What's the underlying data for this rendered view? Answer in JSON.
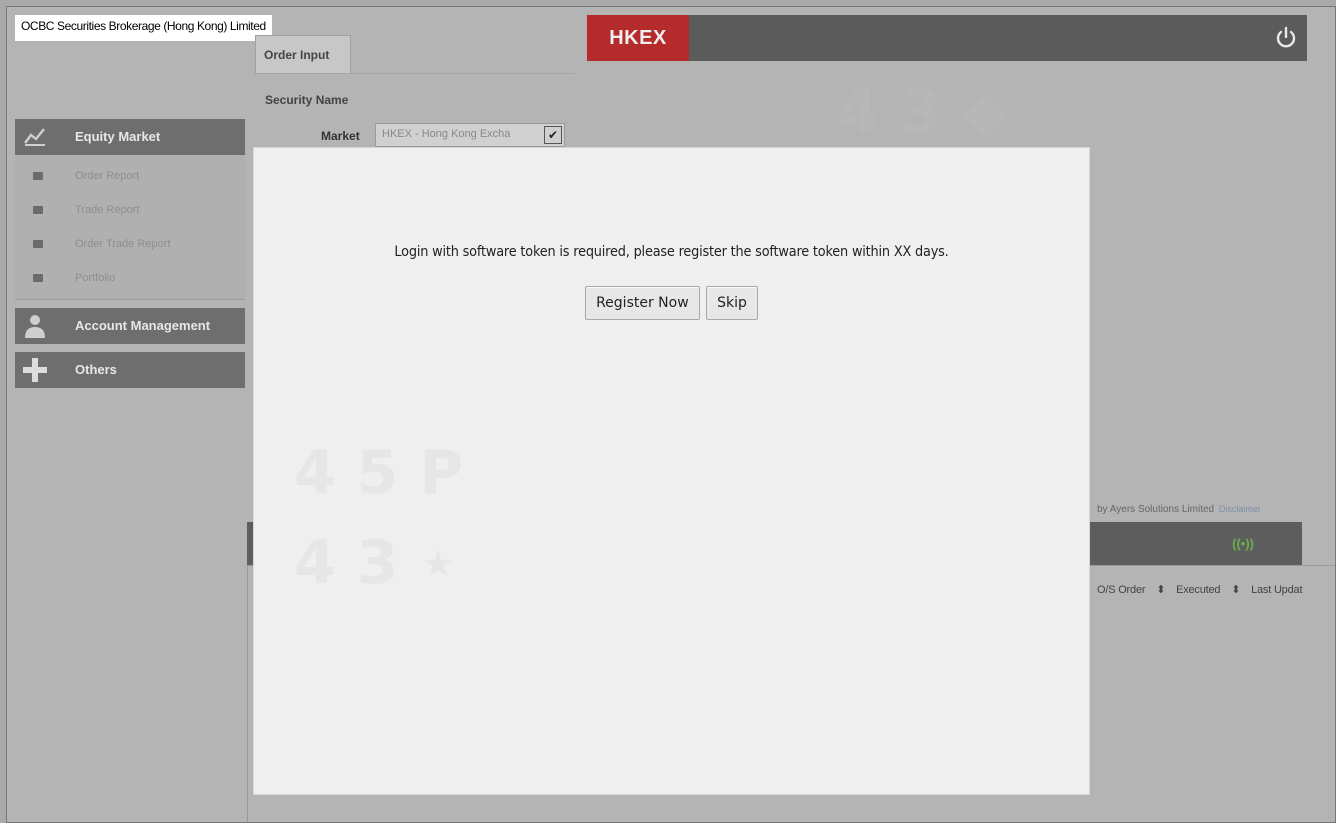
{
  "company": "OCBC Securities Brokerage (Hong Kong) Limited",
  "tabs": {
    "order_input": "Order Input"
  },
  "header": {
    "exchange_logo": "HKEX"
  },
  "order_form": {
    "security_name_label": "Security Name",
    "market_label": "Market",
    "market_value": "HKEX - Hong Kong Excha"
  },
  "sidebar": {
    "equity_market": "Equity Market",
    "items": [
      {
        "label": "Order Report"
      },
      {
        "label": "Trade Report"
      },
      {
        "label": "Order Trade Report"
      },
      {
        "label": "Portfolio"
      }
    ],
    "account_management": "Account Management",
    "others": "Others"
  },
  "footer": {
    "credit": "by Ayers Solutions Limited",
    "disclaimer": "Disclaimer"
  },
  "table": {
    "columns": [
      "O/S Order",
      "Executed",
      "Last Updat"
    ]
  },
  "modal": {
    "message": "Login with software token is required, please register the software  token within XX days.",
    "register_label": "Register Now",
    "skip_label": "Skip"
  },
  "icons": {
    "power": "power-icon",
    "chart": "chart-icon",
    "account": "account-icon",
    "plus": "plus-icon",
    "signal": "signal-icon"
  }
}
